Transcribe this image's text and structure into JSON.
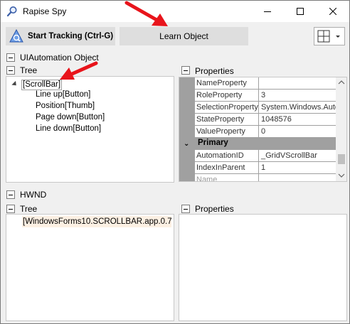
{
  "window": {
    "title": "Rapise Spy",
    "icon": "magnifier-icon"
  },
  "toolbar": {
    "start_tracking_label": "Start Tracking (Ctrl-G)",
    "learn_object_label": "Learn Object",
    "layout_icon": "grid-layout-icon"
  },
  "uia": {
    "section_title": "UIAutomation Object",
    "tree_title": "Tree",
    "properties_title": "Properties",
    "tree": {
      "root": "[ScrollBar]",
      "children": [
        "Line up[Button]",
        "Position[Thumb]",
        "Page down[Button]",
        "Line down[Button]"
      ]
    },
    "properties": {
      "rows_top": [
        {
          "name": "NameProperty",
          "value": ""
        },
        {
          "name": "RoleProperty",
          "value": "3"
        },
        {
          "name": "SelectionProperty",
          "value": "System.Windows.Auto"
        },
        {
          "name": "StateProperty",
          "value": "1048576"
        },
        {
          "name": "ValueProperty",
          "value": "0"
        }
      ],
      "category": "Primary",
      "rows_primary": [
        {
          "name": "AutomationID",
          "value": "_GridVScrollBar"
        },
        {
          "name": "IndexInParent",
          "value": "1"
        },
        {
          "name": "Name",
          "value": ""
        }
      ]
    }
  },
  "hwnd": {
    "section_title": "HWND",
    "tree_title": "Tree",
    "properties_title": "Properties",
    "tree_item": "[WindowsForms10.SCROLLBAR.app.0.7"
  },
  "colors": {
    "arrow": "#e8141b",
    "selected_tree_bg": "#fcf0e3",
    "grid_gutter": "#a0a0a0",
    "button_bg": "#dedede"
  }
}
